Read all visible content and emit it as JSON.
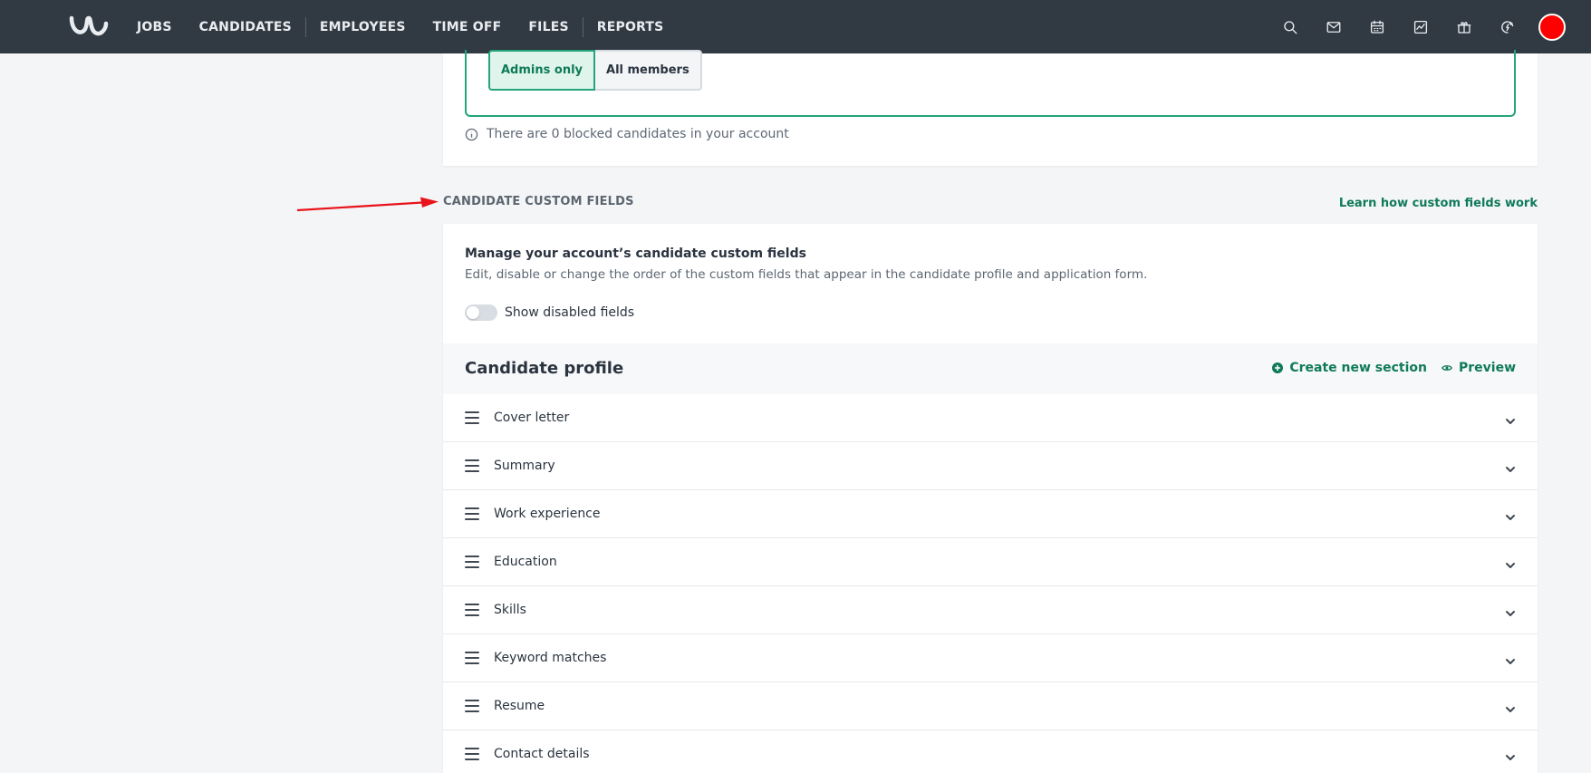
{
  "nav": {
    "items": [
      "JOBS",
      "CANDIDATES",
      "EMPLOYEES",
      "TIME OFF",
      "FILES",
      "REPORTS"
    ],
    "icons": [
      "search-icon",
      "mail-icon",
      "calendar-icon",
      "chart-icon",
      "gift-icon",
      "updates-icon"
    ],
    "avatar_color": "#ff0000"
  },
  "visibility": {
    "options": [
      "Admins only",
      "All members"
    ],
    "selected": "Admins only",
    "blocked_note": "There are 0 blocked candidates in your account"
  },
  "custom_fields": {
    "heading": "CANDIDATE CUSTOM FIELDS",
    "learn_link": "Learn how custom fields work",
    "title": "Manage your account’s candidate custom fields",
    "description": "Edit, disable or change the order of the custom fields that appear in the candidate profile and application form.",
    "toggle_label": "Show disabled fields",
    "toggle_on": false,
    "profile": {
      "title": "Candidate profile",
      "create_section": "Create new section",
      "preview": "Preview",
      "fields": [
        "Cover letter",
        "Summary",
        "Work experience",
        "Education",
        "Skills",
        "Keyword matches",
        "Resume",
        "Contact details"
      ]
    }
  },
  "colors": {
    "accent": "#0f7a59",
    "nav_bg": "#313942",
    "annotation": "#e8131b"
  }
}
